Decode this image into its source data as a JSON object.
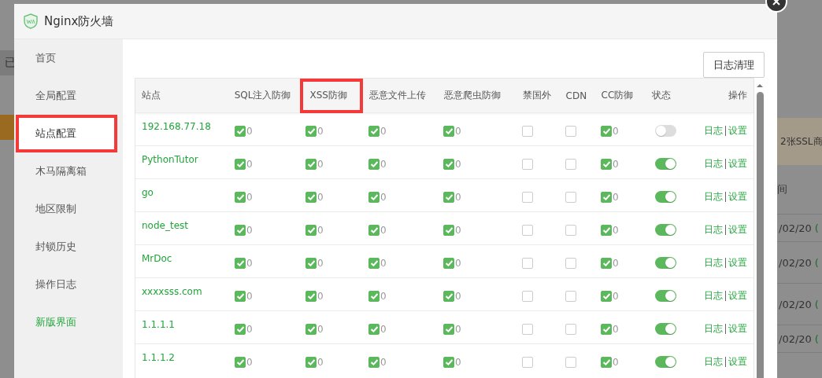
{
  "background_page": {
    "left_texts": [
      "已"
    ],
    "banner": "2张SSL商",
    "column_heading": "间",
    "dates": [
      {
        "date": "/02/20",
        "note": "("
      },
      {
        "date": "/02/20",
        "note": "("
      },
      {
        "date": "/02/20",
        "note": "("
      },
      {
        "date": "/02/20",
        "note": "("
      }
    ]
  },
  "window": {
    "title": "Nginx防火墙"
  },
  "sidebar": {
    "items": [
      {
        "label": "首页",
        "selected": false,
        "highlighted": false,
        "kind": "nav"
      },
      {
        "label": "全局配置",
        "selected": false,
        "highlighted": false,
        "kind": "nav"
      },
      {
        "label": "站点配置",
        "selected": true,
        "highlighted": true,
        "kind": "nav"
      },
      {
        "label": "木马隔离箱",
        "selected": false,
        "highlighted": false,
        "kind": "nav"
      },
      {
        "label": "地区限制",
        "selected": false,
        "highlighted": false,
        "kind": "nav"
      },
      {
        "label": "封锁历史",
        "selected": false,
        "highlighted": false,
        "kind": "nav"
      },
      {
        "label": "操作日志",
        "selected": false,
        "highlighted": false,
        "kind": "nav"
      },
      {
        "label": "新版界面",
        "selected": false,
        "highlighted": false,
        "kind": "link"
      }
    ]
  },
  "toolbar": {
    "button": "日志清理"
  },
  "table": {
    "columns": [
      {
        "label": "站点",
        "highlighted": false
      },
      {
        "label": "SQL注入防御",
        "highlighted": false
      },
      {
        "label": "XSS防御",
        "highlighted": true
      },
      {
        "label": "恶意文件上传",
        "highlighted": false
      },
      {
        "label": "恶意爬虫防御",
        "highlighted": false
      },
      {
        "label": "禁国外",
        "highlighted": false
      },
      {
        "label": "CDN",
        "highlighted": false
      },
      {
        "label": "CC防御",
        "highlighted": false
      },
      {
        "label": "状态",
        "highlighted": false
      },
      {
        "label": "操作",
        "highlighted": false
      }
    ],
    "rows": [
      {
        "cells": [
          {
            "kind": "site",
            "text": "192.168.77.18"
          },
          {
            "kind": "check",
            "checked": true,
            "count": "0"
          },
          {
            "kind": "check",
            "checked": true,
            "count": "0"
          },
          {
            "kind": "check",
            "checked": true,
            "count": "0"
          },
          {
            "kind": "check",
            "checked": true,
            "count": "0"
          },
          {
            "kind": "check",
            "checked": false
          },
          {
            "kind": "check",
            "checked": false
          },
          {
            "kind": "check",
            "checked": true,
            "count": "0"
          },
          {
            "kind": "switch",
            "on": false
          },
          {
            "kind": "actions",
            "actions": [
              "日志",
              "设置"
            ]
          }
        ]
      },
      {
        "cells": [
          {
            "kind": "site",
            "text": "PythonTutor"
          },
          {
            "kind": "check",
            "checked": true,
            "count": "0"
          },
          {
            "kind": "check",
            "checked": true,
            "count": "0"
          },
          {
            "kind": "check",
            "checked": true,
            "count": "0"
          },
          {
            "kind": "check",
            "checked": true,
            "count": "0"
          },
          {
            "kind": "check",
            "checked": false
          },
          {
            "kind": "check",
            "checked": false
          },
          {
            "kind": "check",
            "checked": true,
            "count": "0"
          },
          {
            "kind": "switch",
            "on": true
          },
          {
            "kind": "actions",
            "actions": [
              "日志",
              "设置"
            ]
          }
        ]
      },
      {
        "cells": [
          {
            "kind": "site",
            "text": "go"
          },
          {
            "kind": "check",
            "checked": true,
            "count": "0"
          },
          {
            "kind": "check",
            "checked": true,
            "count": "0"
          },
          {
            "kind": "check",
            "checked": true,
            "count": "0"
          },
          {
            "kind": "check",
            "checked": true,
            "count": "0"
          },
          {
            "kind": "check",
            "checked": false
          },
          {
            "kind": "check",
            "checked": false
          },
          {
            "kind": "check",
            "checked": true,
            "count": "0"
          },
          {
            "kind": "switch",
            "on": true
          },
          {
            "kind": "actions",
            "actions": [
              "日志",
              "设置"
            ]
          }
        ]
      },
      {
        "cells": [
          {
            "kind": "site",
            "text": "node_test"
          },
          {
            "kind": "check",
            "checked": true,
            "count": "0"
          },
          {
            "kind": "check",
            "checked": true,
            "count": "0"
          },
          {
            "kind": "check",
            "checked": true,
            "count": "0"
          },
          {
            "kind": "check",
            "checked": true,
            "count": "0"
          },
          {
            "kind": "check",
            "checked": false
          },
          {
            "kind": "check",
            "checked": false
          },
          {
            "kind": "check",
            "checked": true,
            "count": "0"
          },
          {
            "kind": "switch",
            "on": true
          },
          {
            "kind": "actions",
            "actions": [
              "日志",
              "设置"
            ]
          }
        ]
      },
      {
        "cells": [
          {
            "kind": "site",
            "text": "MrDoc"
          },
          {
            "kind": "check",
            "checked": true,
            "count": "0"
          },
          {
            "kind": "check",
            "checked": true,
            "count": "0"
          },
          {
            "kind": "check",
            "checked": true,
            "count": "0"
          },
          {
            "kind": "check",
            "checked": true,
            "count": "0"
          },
          {
            "kind": "check",
            "checked": false
          },
          {
            "kind": "check",
            "checked": false
          },
          {
            "kind": "check",
            "checked": true,
            "count": "0"
          },
          {
            "kind": "switch",
            "on": true
          },
          {
            "kind": "actions",
            "actions": [
              "日志",
              "设置"
            ]
          }
        ]
      },
      {
        "cells": [
          {
            "kind": "site",
            "text": "xxxxsss.com"
          },
          {
            "kind": "check",
            "checked": true,
            "count": "0"
          },
          {
            "kind": "check",
            "checked": true,
            "count": "0"
          },
          {
            "kind": "check",
            "checked": true,
            "count": "0"
          },
          {
            "kind": "check",
            "checked": true,
            "count": "0"
          },
          {
            "kind": "check",
            "checked": false
          },
          {
            "kind": "check",
            "checked": false
          },
          {
            "kind": "check",
            "checked": true,
            "count": "0"
          },
          {
            "kind": "switch",
            "on": true
          },
          {
            "kind": "actions",
            "actions": [
              "日志",
              "设置"
            ]
          }
        ]
      },
      {
        "cells": [
          {
            "kind": "site",
            "text": "1.1.1.1"
          },
          {
            "kind": "check",
            "checked": true,
            "count": "0"
          },
          {
            "kind": "check",
            "checked": true,
            "count": "0"
          },
          {
            "kind": "check",
            "checked": true,
            "count": "0"
          },
          {
            "kind": "check",
            "checked": true,
            "count": "0"
          },
          {
            "kind": "check",
            "checked": false
          },
          {
            "kind": "check",
            "checked": false
          },
          {
            "kind": "check",
            "checked": true,
            "count": "0"
          },
          {
            "kind": "switch",
            "on": true
          },
          {
            "kind": "actions",
            "actions": [
              "日志",
              "设置"
            ]
          }
        ]
      },
      {
        "cells": [
          {
            "kind": "site",
            "text": "1.1.1.2"
          },
          {
            "kind": "check",
            "checked": true,
            "count": "0"
          },
          {
            "kind": "check",
            "checked": true,
            "count": "0"
          },
          {
            "kind": "check",
            "checked": true,
            "count": "0"
          },
          {
            "kind": "check",
            "checked": true,
            "count": "0"
          },
          {
            "kind": "check",
            "checked": false
          },
          {
            "kind": "check",
            "checked": false
          },
          {
            "kind": "check",
            "checked": true,
            "count": "0"
          },
          {
            "kind": "switch",
            "on": true
          },
          {
            "kind": "actions",
            "actions": [
              "日志",
              "设置"
            ]
          }
        ]
      }
    ]
  }
}
